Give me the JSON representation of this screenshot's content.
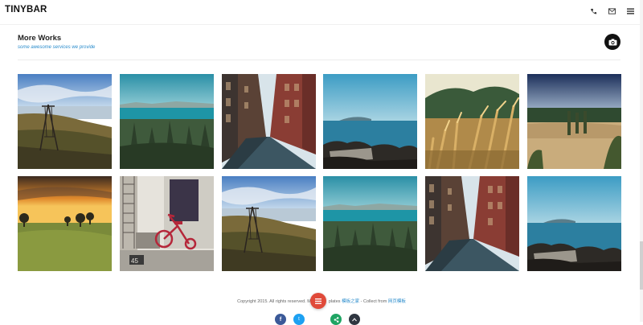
{
  "topbar": {
    "brand": "TINYBAR",
    "icons": [
      "phone-icon",
      "mail-icon",
      "menu-icon"
    ]
  },
  "section": {
    "title": "More Works",
    "subtitle": "some awesome services we provide",
    "action_icon": "camera-icon"
  },
  "gallery": {
    "tiles": [
      {
        "scene": "lakeside-swing"
      },
      {
        "scene": "lake-pines"
      },
      {
        "scene": "city-street"
      },
      {
        "scene": "rocky-shore"
      },
      {
        "scene": "wheat-field"
      },
      {
        "scene": "desert-hill"
      },
      {
        "scene": "sunset-meadow"
      },
      {
        "scene": "red-tricycle"
      },
      {
        "scene": "lakeside-swing"
      },
      {
        "scene": "lake-pines"
      },
      {
        "scene": "city-street"
      },
      {
        "scene": "rocky-shore"
      }
    ]
  },
  "footer": {
    "text_before": "Copyright 2015. All rights reserved. M",
    "text_middle": "plates",
    "link1": "模板之家",
    "text_after": " - Collect from ",
    "link2": "网页模板",
    "fab_icon": "list-icon"
  },
  "social": [
    {
      "icon": "facebook-icon",
      "color": "#3b5998"
    },
    {
      "icon": "twitter-icon",
      "color": "#1da1f2"
    },
    {
      "icon": "share-icon",
      "color": "#1fa463"
    },
    {
      "icon": "chevron-up-icon",
      "color": "#2f3640"
    }
  ],
  "colors": {
    "accent_blue": "#2a8ccc",
    "fab_red": "#e04a3a"
  }
}
